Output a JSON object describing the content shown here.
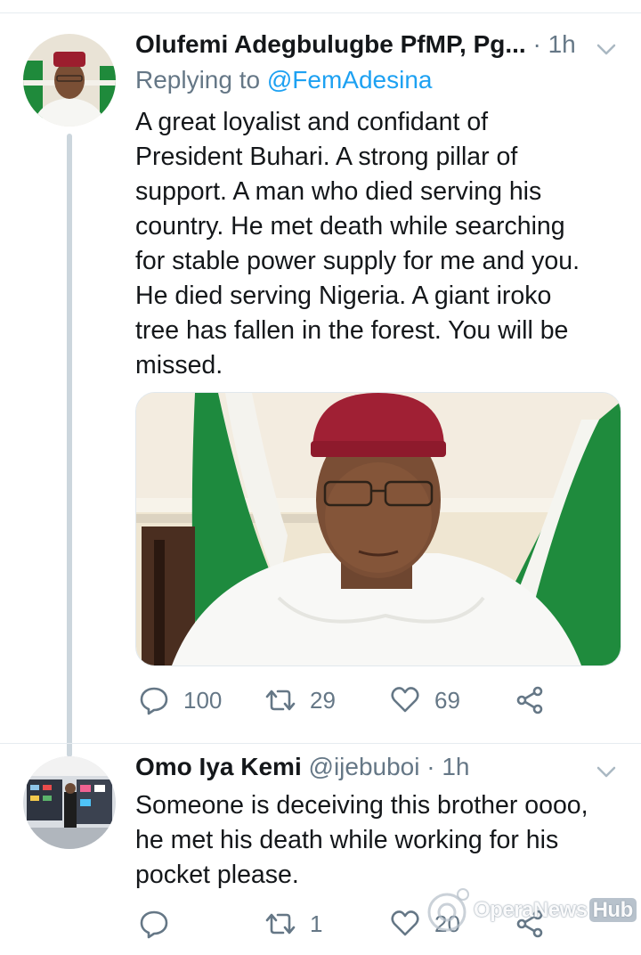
{
  "tweet1": {
    "display_name": "Olufemi Adegbulugbe PfMP, Pg...",
    "separator": "·",
    "time": "1h",
    "replying_label": "Replying to",
    "replying_to": "@FemAdesina",
    "text": "A great loyalist and confidant of President Buhari. A strong pillar of support. A man who died serving his country. He met death while searching for stable power supply for me and you. He died serving Nigeria.  A giant iroko tree has fallen in the forest.  You will be missed.",
    "lines": [
      "A great loyalist and confidant of",
      "President Buhari. A strong pillar of",
      "support. A man who died serving his",
      "country. He met death while searching",
      "for stable power supply for me and you.",
      "He died serving Nigeria.  A giant iroko",
      "tree has fallen in the forest.  You will be",
      "missed."
    ],
    "replies": "100",
    "retweets": "29",
    "likes": "69"
  },
  "tweet2": {
    "display_name": "Omo Iya Kemi",
    "handle": "@ijebuboi",
    "separator": "·",
    "time": "1h",
    "lines": [
      "Someone is deceiving this brother oooo,",
      "he met his death while working for his",
      "pocket please."
    ],
    "replies": "",
    "retweets": "1",
    "likes": "20"
  },
  "watermark": {
    "part1": "Opera",
    "part2": "News",
    "part3": "Hub"
  },
  "colors": {
    "link": "#1da1f2",
    "secondary": "#657786",
    "thread_line": "#ccd6dd"
  },
  "icons": [
    "reply-icon",
    "retweet-icon",
    "like-icon",
    "share-icon",
    "chevron-down-icon"
  ]
}
